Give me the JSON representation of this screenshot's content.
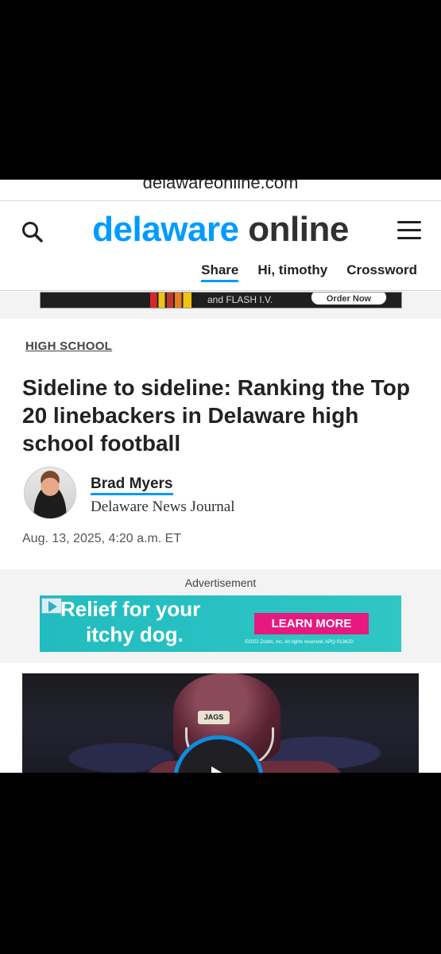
{
  "browser": {
    "url_text": "delawareonline.com"
  },
  "header": {
    "logo_part1": "delaware",
    "logo_part2": "online",
    "nav": {
      "share": "Share",
      "greeting": "Hi, timothy",
      "crossword": "Crossword"
    },
    "icons": {
      "search": "search-icon",
      "menu": "hamburger-menu-icon"
    }
  },
  "top_ad": {
    "text": "and FLASH I.V.",
    "cta": "Order Now"
  },
  "article": {
    "category": "HIGH SCHOOL",
    "headline": "Sideline to sideline: Ranking the Top 20 linebackers in Delaware high school football",
    "author": "Brad Myers",
    "organization": "Delaware News Journal",
    "dateline": "Aug. 13, 2025, 4:20 a.m. ET"
  },
  "advertisement": {
    "label": "Advertisement",
    "line1": "Relief for your",
    "line2": "itchy dog.",
    "cta": "LEARN MORE",
    "fine_print": "©2022 Zoetis, Inc. All rights reserved. APQ-01362D"
  },
  "video": {
    "helmet_text": "JAGS",
    "play_icon": "play-icon"
  },
  "colors": {
    "brand_blue": "#009bff",
    "ad_teal": "#2fc6c4",
    "ad_pink": "#e6197e",
    "play_ring": "#0f8cdf"
  }
}
